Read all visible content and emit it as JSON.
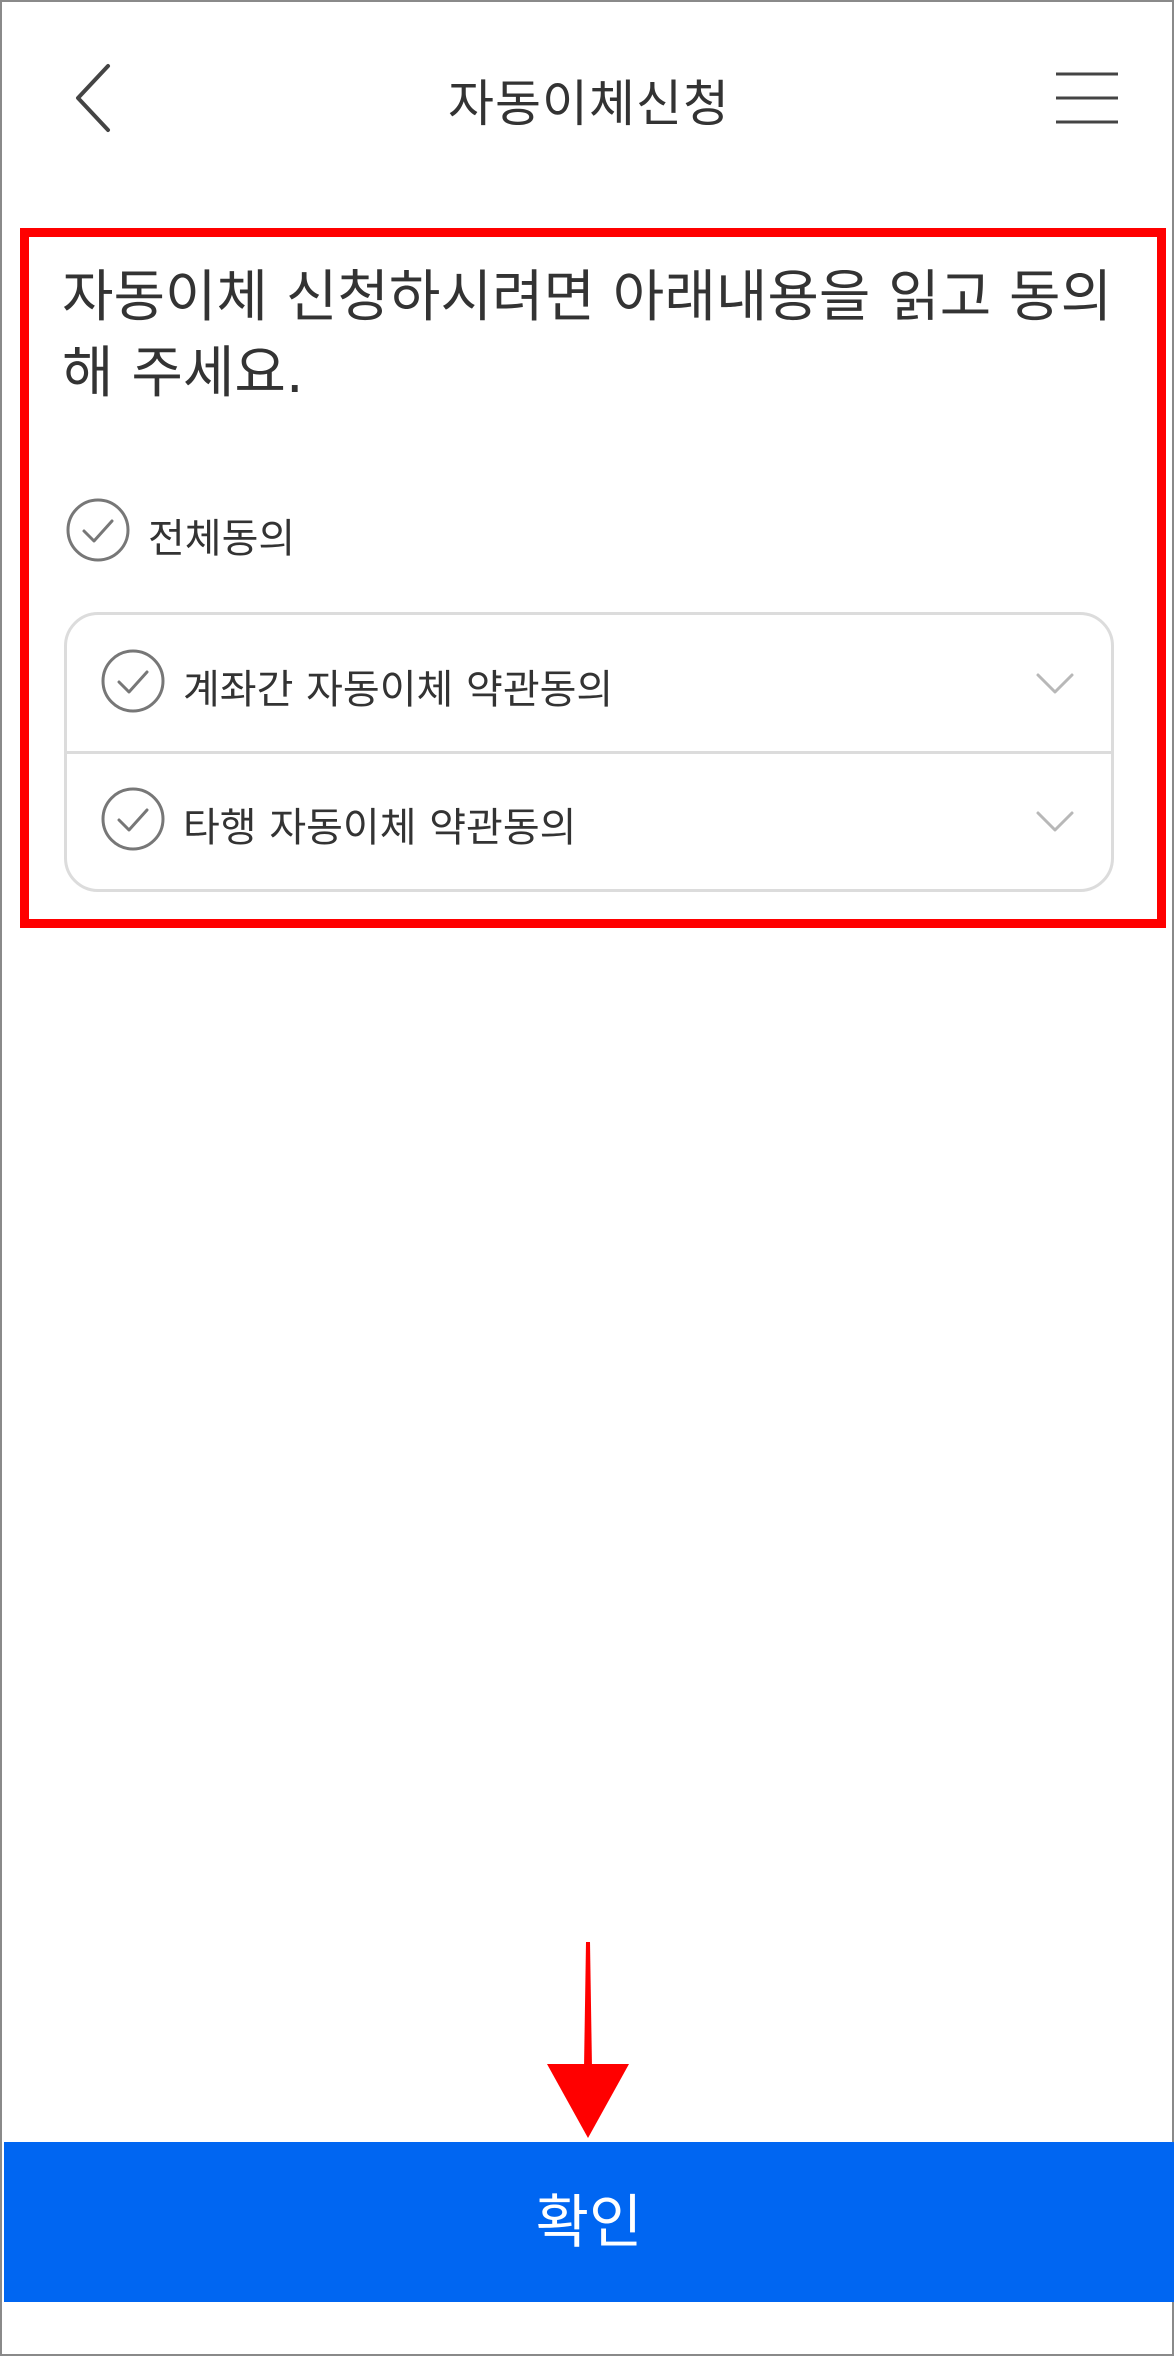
{
  "header": {
    "title": "자동이체신청",
    "back_icon": "chevron-left-icon",
    "menu_icon": "hamburger-menu-icon"
  },
  "agreement": {
    "instruction": "자동이체 신청하시려면 아래내용을 읽고 동의해 주세요.",
    "all_agree_label": "전체동의",
    "terms": [
      {
        "label": "계좌간 자동이체 약관동의",
        "icon": "chevron-down-icon"
      },
      {
        "label": "타행 자동이체 약관동의",
        "icon": "chevron-down-icon"
      }
    ]
  },
  "footer": {
    "confirm_label": "확인"
  },
  "colors": {
    "accent": "#0066f2",
    "highlight": "#ff0000",
    "text": "#333333",
    "border": "#dcdcdc"
  }
}
